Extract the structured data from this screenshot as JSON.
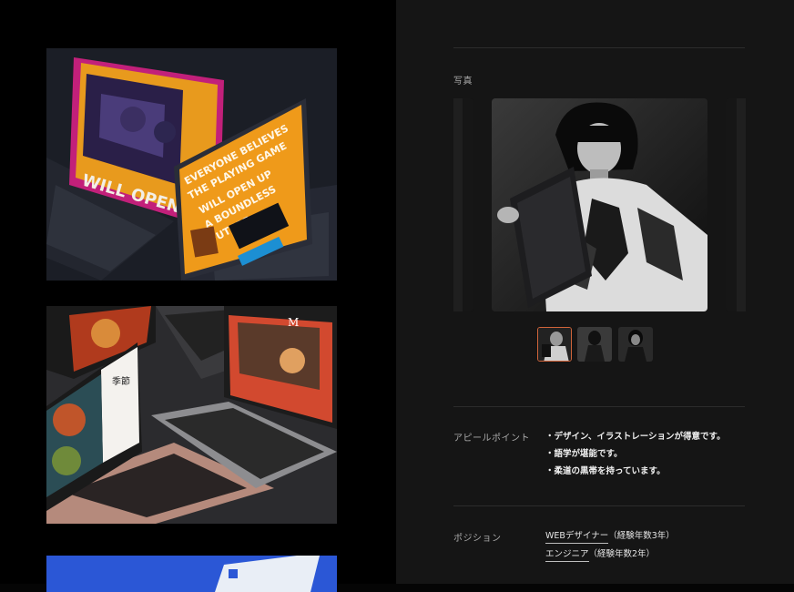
{
  "photo_section": {
    "label": "写真"
  },
  "appeal_section": {
    "label": "アピールポイント",
    "items": [
      "・デザイン、イラストレーションが得意です。",
      "・語学が堪能です。",
      "・柔道の黒帯を持っています。"
    ]
  },
  "position_section": {
    "label": "ポジション",
    "items": [
      {
        "link": "WEBデザイナー",
        "note": "（経験年数3年）"
      },
      {
        "link": "エンジニア",
        "note": "（経験年数2年）"
      }
    ]
  },
  "mockup1": {
    "screen_text": "EVERYONE BELIEVES THE PLAYING GAME WILL OPEN UP A BOUNDLESS FUTURE.",
    "back_screen_text": "WILL OPEN U"
  },
  "mockup2": {
    "menu_title": "季節",
    "brand_letter": "M"
  },
  "carousel": {
    "active_index": 0,
    "total": 3
  },
  "colors": {
    "accent": "#d0643a",
    "right_panel": "#151515",
    "left_panel": "#000000"
  }
}
